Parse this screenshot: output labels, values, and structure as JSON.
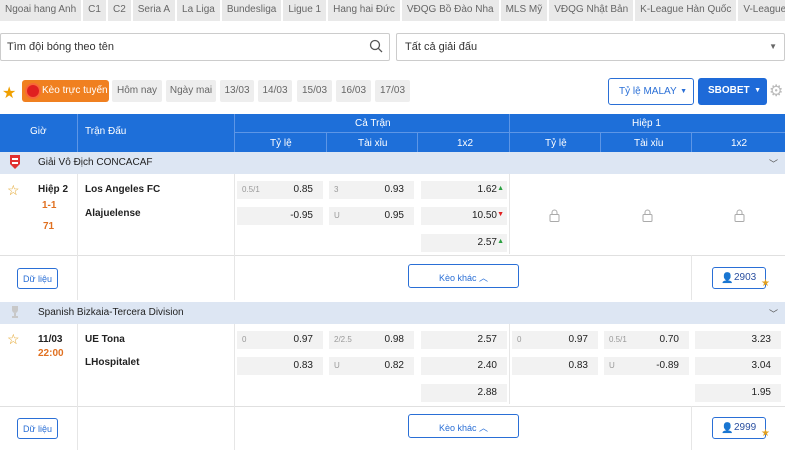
{
  "leagues": [
    "Ngoai hang Anh",
    "C1",
    "C2",
    "Seria A",
    "La Liga",
    "Bundesliga",
    "Ligue 1",
    "Hang hai Đức",
    "VĐQG Bồ Đào Nha",
    "MLS Mỹ",
    "VĐQG Nhật Bản",
    "K-League Hàn Quốc",
    "V-League"
  ],
  "search": {
    "placeholder": "Tìm đội bóng theo tên",
    "league_select": "Tất cả giải đấu"
  },
  "dates": {
    "live": "Kèo trực tuyến",
    "today": "Hôm nay",
    "tomorrow": "Ngày mai",
    "days": [
      "13/03",
      "14/03",
      "15/03",
      "16/03",
      "17/03"
    ]
  },
  "controls": {
    "rate": "Tỷ lệ MALAY",
    "book": "SBOBET"
  },
  "header": {
    "time": "Giờ",
    "match": "Trận Đấu",
    "full": "Cả Trận",
    "half": "Hiệp 1",
    "handicap": "Tỷ lệ",
    "ou": "Tài xỉu",
    "x12": "1x2"
  },
  "groups": [
    {
      "league": "Giải Vô Địch CONCACAF",
      "status": "Hiệp 2",
      "score": "1-1",
      "minute": "71",
      "home": "Los Angeles FC",
      "away": "Alajuelense",
      "full_hdp": [
        {
          "line": "0.5/1",
          "val": "0.85"
        },
        {
          "line": "",
          "val": "-0.95"
        }
      ],
      "full_ou": [
        {
          "line": "3",
          "val": "0.93"
        },
        {
          "line": "U",
          "val": "0.95"
        }
      ],
      "full_x12": [
        "1.62",
        "10.50",
        "2.57"
      ],
      "half_hdp": [],
      "half_ou": [],
      "half_x12": [],
      "data_btn": "Dữ liệu",
      "more_btn": "Kèo khác",
      "count": "2903"
    },
    {
      "league": "Spanish Bizkaia-Tercera Division",
      "status": "11/03",
      "minute": "22:00",
      "home": "UE Tona",
      "away": "LHospitalet",
      "full_hdp": [
        {
          "line": "0",
          "val": "0.97"
        },
        {
          "line": "",
          "val": "0.83"
        }
      ],
      "full_ou": [
        {
          "line": "2/2.5",
          "val": "0.98"
        },
        {
          "line": "U",
          "val": "0.82"
        }
      ],
      "full_x12": [
        "2.57",
        "2.40",
        "2.88"
      ],
      "half_hdp": [
        {
          "line": "0",
          "val": "0.97"
        },
        {
          "line": "",
          "val": "0.83"
        }
      ],
      "half_ou": [
        {
          "line": "0.5/1",
          "val": "0.70"
        },
        {
          "line": "U",
          "val": "-0.89"
        }
      ],
      "half_x12": [
        "3.23",
        "3.04",
        "1.95"
      ],
      "data_btn": "Dữ liệu",
      "more_btn": "Kèo khác",
      "count": "2999"
    }
  ],
  "colors": {
    "header_blue": "#1e6fd9",
    "live_orange": "#f08020",
    "live_score": "#e07020",
    "odds_up": "#2aa040",
    "odds_down": "#e02020"
  }
}
